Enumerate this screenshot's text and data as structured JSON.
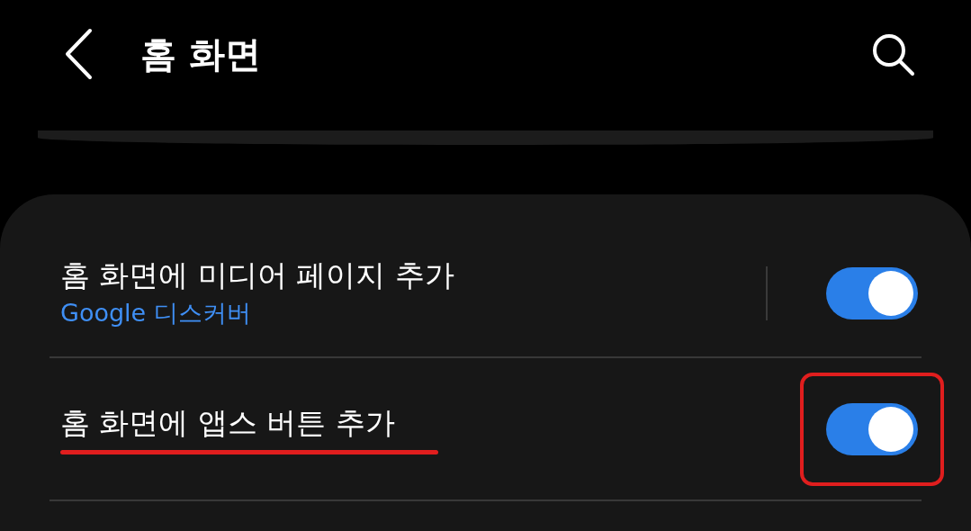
{
  "header": {
    "title": "홈 화면"
  },
  "settings": [
    {
      "title": "홈 화면에 미디어 페이지 추가",
      "subtitle": "Google 디스커버",
      "on": true,
      "underlined": false,
      "boxed": false
    },
    {
      "title": "홈 화면에 앱스 버튼 추가",
      "on": true,
      "underlined": true,
      "boxed": true
    }
  ]
}
